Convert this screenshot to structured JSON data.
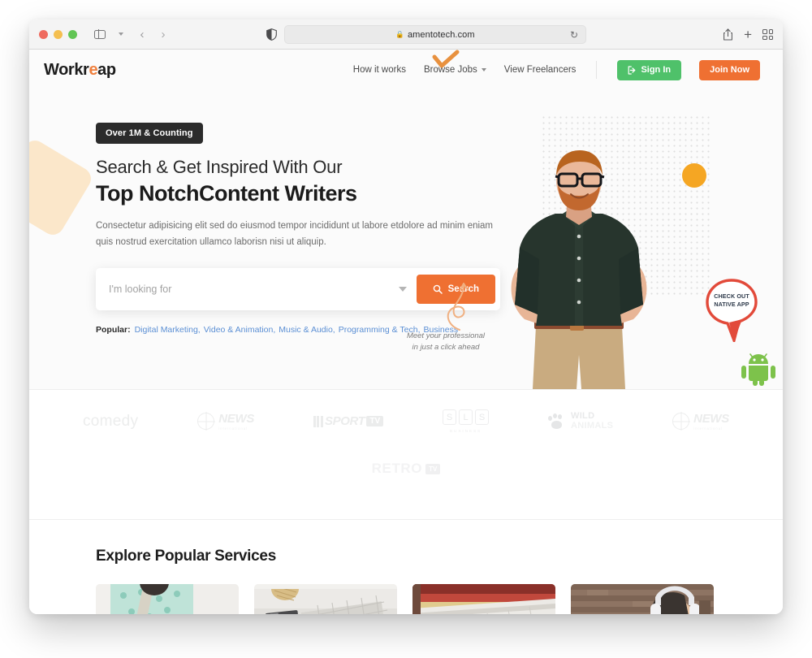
{
  "browser": {
    "url": "amentotech.com",
    "lock_icon": "lock-icon",
    "reload_icon": "reload-icon",
    "back_icon": "back-arrow-icon",
    "forward_icon": "forward-arrow-icon",
    "sidebar_icon": "sidebar-toggle-icon",
    "share_icon": "share-icon",
    "newtab_icon": "plus-icon",
    "tabs_icon": "tab-overview-icon",
    "shield_icon": "privacy-shield-icon"
  },
  "site": {
    "logo": {
      "pre": "Workr",
      "accent": "e",
      "post": "ap"
    },
    "nav": [
      {
        "label": "How it works",
        "has_caret": false
      },
      {
        "label": "Browse Jobs",
        "has_caret": true
      },
      {
        "label": "View Freelancers",
        "has_caret": false
      }
    ],
    "sign_in": "Sign In",
    "join_now": "Join Now"
  },
  "hero": {
    "badge": "Over 1M & Counting",
    "heading_line1": "Search & Get Inspired With Our",
    "heading_line2": "Top NotchContent Writers",
    "description": "Consectetur adipisicing elit sed do eiusmod tempor incididunt ut labore etdolore ad minim eniam quis nostrud exercitation ullamco laborisn nisi ut aliquip.",
    "search_placeholder": "I'm looking for",
    "search_value": "",
    "search_button": "Search",
    "popular_label": "Popular:",
    "popular_tags": [
      "Digital Marketing,",
      "Video & Animation,",
      "Music & Audio,",
      "Programming & Tech,",
      "Business"
    ],
    "note_line1": "Meet your professional",
    "note_line2": "in just a click ahead",
    "app_badge_line1": "CHECK OUT",
    "app_badge_line2": "NATIVE APP",
    "android_icon": "android-robot-icon",
    "accent_color": "#ef7032",
    "green_color": "#4fc16a"
  },
  "brands": {
    "row1": [
      {
        "name": "comedy",
        "text": "comedy"
      },
      {
        "name": "news-international",
        "text": "NEWS",
        "sub": "international"
      },
      {
        "name": "sport-tv",
        "text": "SPORT",
        "tv": "TV"
      },
      {
        "name": "sls-business",
        "letters": [
          "S",
          "L",
          "S"
        ],
        "cap": "BUSINESS"
      },
      {
        "name": "wild-animals",
        "text1": "WILD",
        "text2": "ANIMALS"
      },
      {
        "name": "news-international-2",
        "text": "NEWS",
        "sub": "international"
      }
    ],
    "row2": [
      {
        "name": "retro-tv",
        "text": "RETRO",
        "tv": "TV"
      }
    ]
  },
  "explore": {
    "title": "Explore Popular Services",
    "cards": [
      {
        "name": "card-fashion",
        "alt": "woman in patterned shirt with bag"
      },
      {
        "name": "card-keyboard",
        "alt": "keyboard and desk accessories"
      },
      {
        "name": "card-laptop",
        "alt": "laptop on red desk"
      },
      {
        "name": "card-headphones",
        "alt": "woman with headphones at brick wall"
      }
    ]
  }
}
